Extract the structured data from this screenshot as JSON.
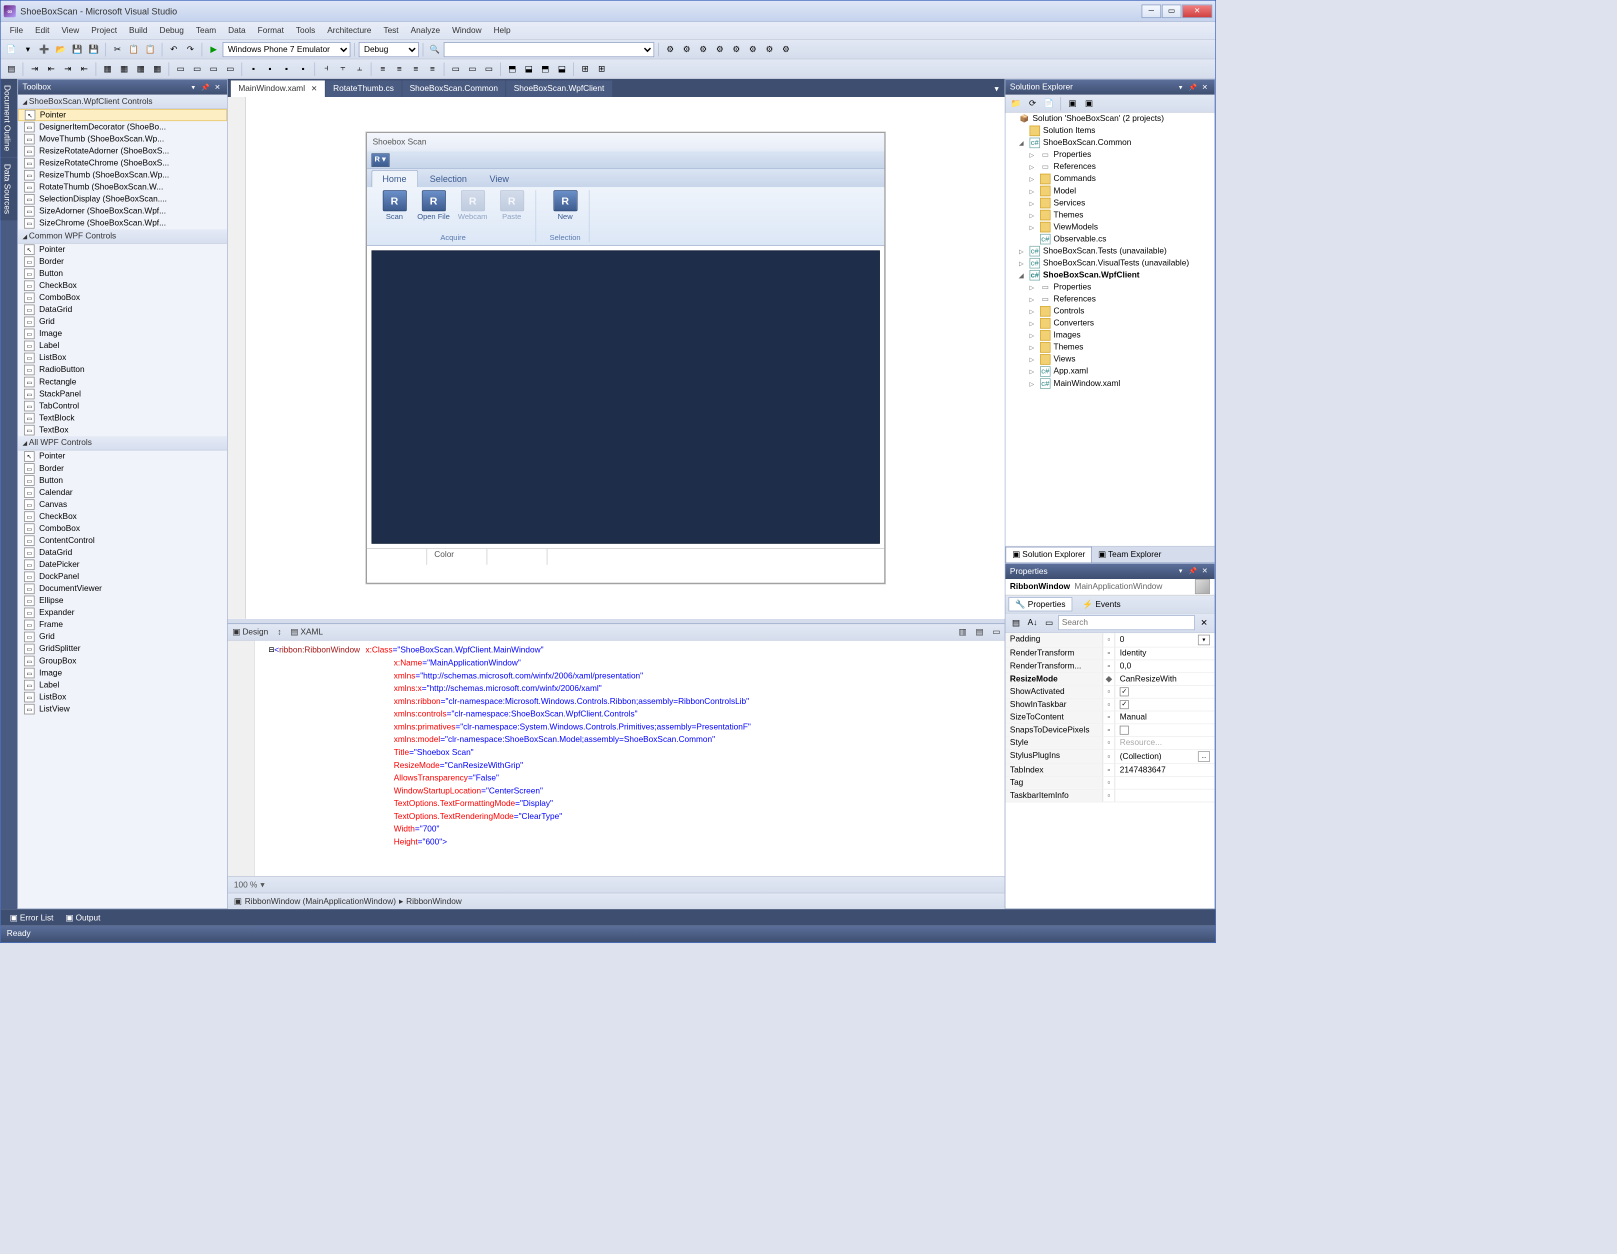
{
  "window": {
    "title": "ShoeBoxScan - Microsoft Visual Studio"
  },
  "menubar": [
    "File",
    "Edit",
    "View",
    "Project",
    "Build",
    "Debug",
    "Team",
    "Data",
    "Format",
    "Tools",
    "Architecture",
    "Test",
    "Analyze",
    "Window",
    "Help"
  ],
  "toolbar": {
    "config": "Debug",
    "platform": "Windows Phone 7 Emulator"
  },
  "left_rail": [
    "Document Outline",
    "Data Sources"
  ],
  "toolbox": {
    "title": "Toolbox",
    "groups": [
      {
        "name": "ShoeBoxScan.WpfClient Controls",
        "items": [
          "Pointer",
          "DesignerItemDecorator (ShoeBo...",
          "MoveThumb (ShoeBoxScan.Wp...",
          "ResizeRotateAdorner (ShoeBoxS...",
          "ResizeRotateChrome (ShoeBoxS...",
          "ResizeThumb (ShoeBoxScan.Wp...",
          "RotateThumb (ShoeBoxScan.W...",
          "SelectionDisplay (ShoeBoxScan....",
          "SizeAdorner (ShoeBoxScan.Wpf...",
          "SizeChrome (ShoeBoxScan.Wpf..."
        ]
      },
      {
        "name": "Common WPF Controls",
        "items": [
          "Pointer",
          "Border",
          "Button",
          "CheckBox",
          "ComboBox",
          "DataGrid",
          "Grid",
          "Image",
          "Label",
          "ListBox",
          "RadioButton",
          "Rectangle",
          "StackPanel",
          "TabControl",
          "TextBlock",
          "TextBox"
        ]
      },
      {
        "name": "All WPF Controls",
        "items": [
          "Pointer",
          "Border",
          "Button",
          "Calendar",
          "Canvas",
          "CheckBox",
          "ComboBox",
          "ContentControl",
          "DataGrid",
          "DatePicker",
          "DockPanel",
          "DocumentViewer",
          "Ellipse",
          "Expander",
          "Frame",
          "Grid",
          "GridSplitter",
          "GroupBox",
          "Image",
          "Label",
          "ListBox",
          "ListView"
        ]
      }
    ]
  },
  "doc_tabs": [
    {
      "label": "MainWindow.xaml",
      "active": true,
      "closeable": true
    },
    {
      "label": "RotateThumb.cs"
    },
    {
      "label": "ShoeBoxScan.Common"
    },
    {
      "label": "ShoeBoxScan.WpfClient"
    }
  ],
  "designer": {
    "zoom": "100%",
    "window_title": "Shoebox Scan",
    "ribbon_tabs": [
      "Home",
      "Selection",
      "View"
    ],
    "ribbon_groups": [
      {
        "name": "Acquire",
        "buttons": [
          {
            "label": "Scan",
            "disabled": false
          },
          {
            "label": "Open File",
            "disabled": false
          },
          {
            "label": "Webcam",
            "disabled": true
          },
          {
            "label": "Paste",
            "disabled": true
          }
        ]
      },
      {
        "name": "Selection",
        "buttons": [
          {
            "label": "New",
            "disabled": false
          }
        ]
      }
    ],
    "status_cells": [
      "",
      "Color",
      ""
    ]
  },
  "code_tabs": {
    "design": "Design",
    "xaml": "XAML"
  },
  "code_zoom": "100 %",
  "xaml": {
    "lines": [
      {
        "pre": "  ⊟",
        "el": "<ribbon:RibbonWindow",
        "attrs": [
          [
            "x:Class",
            "ShoeBoxScan.WpfClient.MainWindow"
          ]
        ]
      },
      {
        "pre": "                        ",
        "attrs": [
          [
            "x:Name",
            "MainApplicationWindow"
          ]
        ]
      },
      {
        "pre": "                        ",
        "attrs": [
          [
            "xmlns",
            "http://schemas.microsoft.com/winfx/2006/xaml/presentation"
          ]
        ]
      },
      {
        "pre": "                        ",
        "attrs": [
          [
            "xmlns:x",
            "http://schemas.microsoft.com/winfx/2006/xaml"
          ]
        ]
      },
      {
        "pre": "                        ",
        "attrs": [
          [
            "xmlns:ribbon",
            "clr-namespace:Microsoft.Windows.Controls.Ribbon;assembly=RibbonControlsLib"
          ]
        ]
      },
      {
        "pre": "                        ",
        "attrs": [
          [
            "xmlns:controls",
            "clr-namespace:ShoeBoxScan.WpfClient.Controls"
          ]
        ]
      },
      {
        "pre": "                        ",
        "attrs": [
          [
            "xmlns:primatives",
            "clr-namespace:System.Windows.Controls.Primitives;assembly=PresentationF"
          ]
        ]
      },
      {
        "pre": "                        ",
        "attrs": [
          [
            "xmlns:model",
            "clr-namespace:ShoeBoxScan.Model;assembly=ShoeBoxScan.Common"
          ]
        ]
      },
      {
        "pre": "                        ",
        "attrs": [
          [
            "Title",
            "Shoebox Scan"
          ]
        ]
      },
      {
        "pre": "                        ",
        "attrs": [
          [
            "ResizeMode",
            "CanResizeWithGrip"
          ]
        ]
      },
      {
        "pre": "                        ",
        "attrs": [
          [
            "AllowsTransparency",
            "False"
          ]
        ]
      },
      {
        "pre": "                        ",
        "attrs": [
          [
            "WindowStartupLocation",
            "CenterScreen"
          ]
        ]
      },
      {
        "pre": "                        ",
        "attrs": [
          [
            "TextOptions.TextFormattingMode",
            "Display"
          ]
        ]
      },
      {
        "pre": "                        ",
        "attrs": [
          [
            "TextOptions.TextRenderingMode",
            "ClearType"
          ]
        ]
      },
      {
        "pre": "                        ",
        "attrs": [
          [
            "Width",
            "700"
          ]
        ]
      },
      {
        "pre": "                        ",
        "attrs": [
          [
            "Height",
            "600"
          ]
        ],
        "close": ">"
      }
    ]
  },
  "breadcrumb": [
    "RibbonWindow (MainApplicationWindow)",
    "RibbonWindow"
  ],
  "solution": {
    "title": "Solution Explorer",
    "root": "Solution 'ShoeBoxScan' (2 projects)",
    "nodes": [
      {
        "d": 1,
        "exp": "",
        "ico": "fold",
        "label": "Solution Items"
      },
      {
        "d": 1,
        "exp": "◢",
        "ico": "cs",
        "label": "ShoeBoxScan.Common"
      },
      {
        "d": 2,
        "exp": "▷",
        "ico": "ref",
        "label": "Properties"
      },
      {
        "d": 2,
        "exp": "▷",
        "ico": "ref",
        "label": "References"
      },
      {
        "d": 2,
        "exp": "▷",
        "ico": "fold",
        "label": "Commands"
      },
      {
        "d": 2,
        "exp": "▷",
        "ico": "fold",
        "label": "Model"
      },
      {
        "d": 2,
        "exp": "▷",
        "ico": "fold",
        "label": "Services"
      },
      {
        "d": 2,
        "exp": "▷",
        "ico": "fold",
        "label": "Themes"
      },
      {
        "d": 2,
        "exp": "▷",
        "ico": "fold",
        "label": "ViewModels"
      },
      {
        "d": 2,
        "exp": "",
        "ico": "cs",
        "label": "Observable.cs"
      },
      {
        "d": 1,
        "exp": "▷",
        "ico": "cs",
        "label": "ShoeBoxScan.Tests (unavailable)"
      },
      {
        "d": 1,
        "exp": "▷",
        "ico": "cs",
        "label": "ShoeBoxScan.VisualTests (unavailable)"
      },
      {
        "d": 1,
        "exp": "◢",
        "ico": "cs",
        "label": "ShoeBoxScan.WpfClient",
        "bold": true
      },
      {
        "d": 2,
        "exp": "▷",
        "ico": "ref",
        "label": "Properties"
      },
      {
        "d": 2,
        "exp": "▷",
        "ico": "ref",
        "label": "References"
      },
      {
        "d": 2,
        "exp": "▷",
        "ico": "fold",
        "label": "Controls"
      },
      {
        "d": 2,
        "exp": "▷",
        "ico": "fold",
        "label": "Converters"
      },
      {
        "d": 2,
        "exp": "▷",
        "ico": "fold",
        "label": "Images"
      },
      {
        "d": 2,
        "exp": "▷",
        "ico": "fold",
        "label": "Themes"
      },
      {
        "d": 2,
        "exp": "▷",
        "ico": "fold",
        "label": "Views"
      },
      {
        "d": 2,
        "exp": "▷",
        "ico": "cs",
        "label": "App.xaml"
      },
      {
        "d": 2,
        "exp": "▷",
        "ico": "cs",
        "label": "MainWindow.xaml"
      }
    ],
    "bottom_tabs": [
      "Solution Explorer",
      "Team Explorer"
    ]
  },
  "properties": {
    "title": "Properties",
    "object": "RibbonWindow",
    "object_name": "MainApplicationWindow",
    "cat_tabs": [
      "Properties",
      "Events"
    ],
    "search_placeholder": "Search",
    "rows": [
      {
        "name": "Padding",
        "val": "0",
        "dd": true
      },
      {
        "name": "RenderTransform",
        "val": "Identity"
      },
      {
        "name": "RenderTransform...",
        "val": "0,0"
      },
      {
        "name": "ResizeMode",
        "val": "CanResizeWith",
        "bold": true,
        "mark": "◆"
      },
      {
        "name": "ShowActivated",
        "val": "",
        "chk": true,
        "checked": true
      },
      {
        "name": "ShowInTaskbar",
        "val": "",
        "chk": true,
        "checked": true
      },
      {
        "name": "SizeToContent",
        "val": "Manual"
      },
      {
        "name": "SnapsToDevicePixels",
        "val": "",
        "chk": true,
        "checked": false
      },
      {
        "name": "Style",
        "val": "Resource...",
        "dim": true
      },
      {
        "name": "StylusPlugIns",
        "val": "(Collection)",
        "btn": "..."
      },
      {
        "name": "TabIndex",
        "val": "2147483647"
      },
      {
        "name": "Tag",
        "val": ""
      },
      {
        "name": "TaskbarItemInfo",
        "val": ""
      }
    ]
  },
  "footer_tabs": [
    "Error List",
    "Output"
  ],
  "status": "Ready"
}
